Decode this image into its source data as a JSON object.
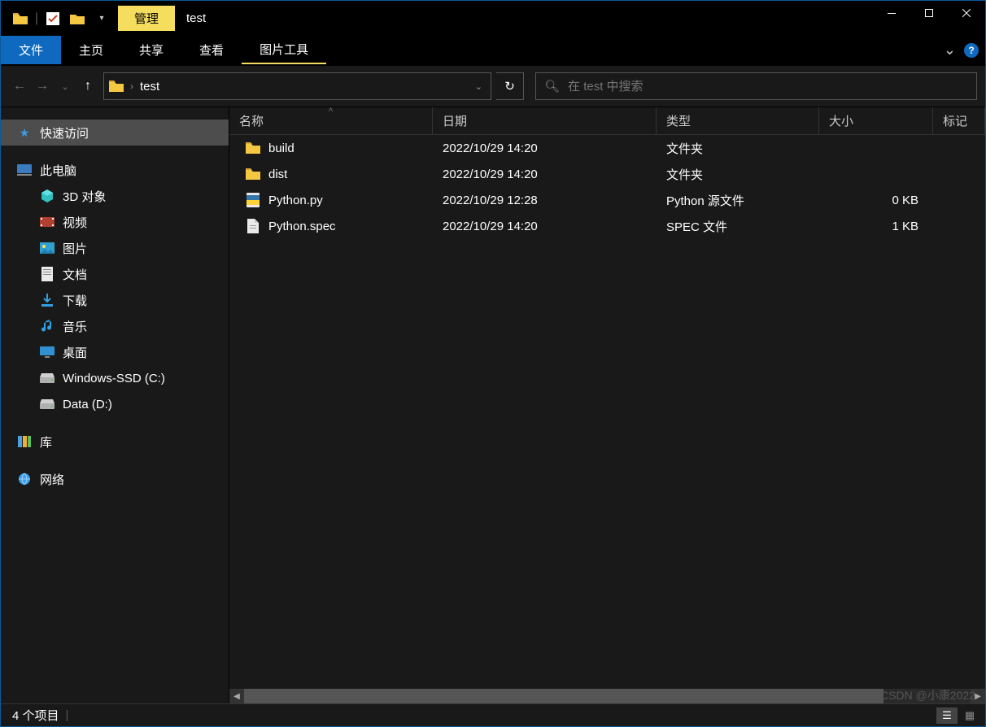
{
  "window": {
    "title": "test",
    "context_tab": "管理"
  },
  "ribbon": {
    "file": "文件",
    "tabs": [
      "主页",
      "共享",
      "查看"
    ],
    "context": "图片工具"
  },
  "nav": {
    "crumb": "test",
    "search_placeholder": "在 test 中搜索"
  },
  "sidebar": {
    "quick_access": "快速访问",
    "this_pc": "此电脑",
    "children": [
      {
        "label": "3D 对象",
        "icon": "3d"
      },
      {
        "label": "视频",
        "icon": "video"
      },
      {
        "label": "图片",
        "icon": "picture"
      },
      {
        "label": "文档",
        "icon": "document"
      },
      {
        "label": "下载",
        "icon": "download"
      },
      {
        "label": "音乐",
        "icon": "music"
      },
      {
        "label": "桌面",
        "icon": "desktop"
      },
      {
        "label": "Windows-SSD (C:)",
        "icon": "drive"
      },
      {
        "label": "Data (D:)",
        "icon": "drive"
      }
    ],
    "libraries": "库",
    "network": "网络"
  },
  "columns": {
    "name": "名称",
    "date": "日期",
    "type": "类型",
    "size": "大小",
    "tag": "标记"
  },
  "files": [
    {
      "name": "build",
      "date": "2022/10/29 14:20",
      "type": "文件夹",
      "size": "",
      "icon": "folder"
    },
    {
      "name": "dist",
      "date": "2022/10/29 14:20",
      "type": "文件夹",
      "size": "",
      "icon": "folder"
    },
    {
      "name": "Python.py",
      "date": "2022/10/29 12:28",
      "type": "Python 源文件",
      "size": "0 KB",
      "icon": "py"
    },
    {
      "name": "Python.spec",
      "date": "2022/10/29 14:20",
      "type": "SPEC 文件",
      "size": "1 KB",
      "icon": "file"
    }
  ],
  "status": {
    "count": "4 个项目"
  },
  "watermark": "CSDN @小康2022"
}
